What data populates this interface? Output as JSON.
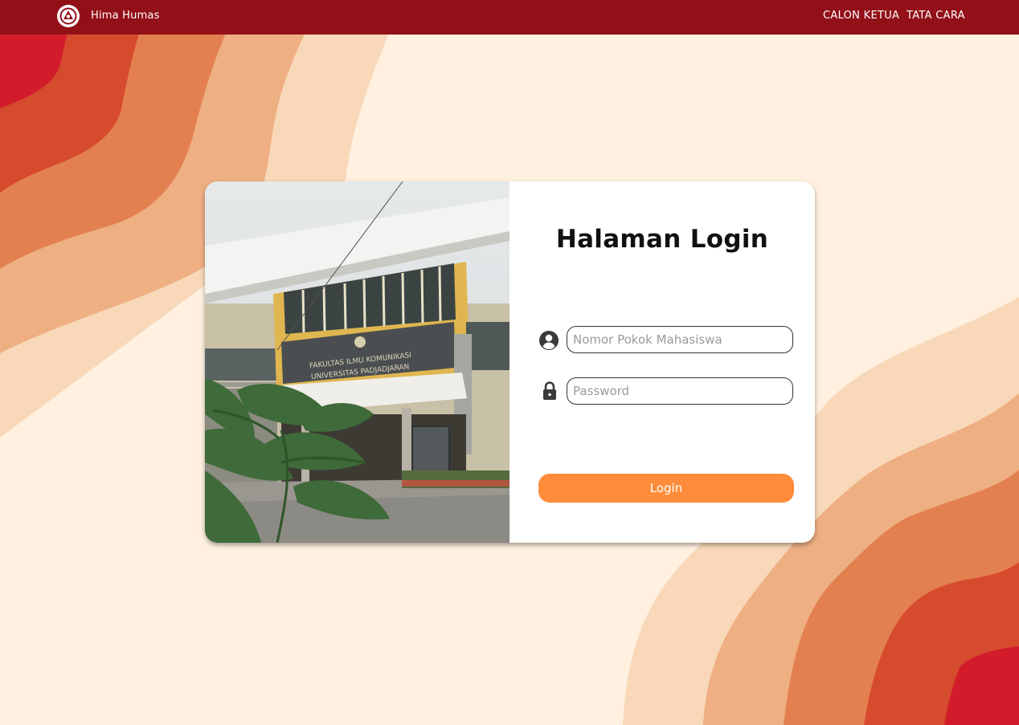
{
  "navbar": {
    "brand_name": "Hima Humas",
    "links": [
      "CALON KETUA",
      "TATA CARA"
    ],
    "background_color": "#921018"
  },
  "login": {
    "title": "Halaman Login",
    "npm_placeholder": "Nomor Pokok Mahasiswa",
    "password_placeholder": "Password",
    "button_label": "Login",
    "button_color": "#ff8c3a"
  },
  "photo": {
    "sign_text_line1": "FAKULTAS ILMU KOMUNIKASI",
    "sign_text_line2": "UNIVERSITAS PADJADJARAN"
  },
  "icons": {
    "brand": "emblem-logo-icon",
    "user": "user-circle-icon",
    "lock": "lock-icon"
  },
  "colors": {
    "background": "#fff0e0",
    "wave_light": "#f8d8b8",
    "wave_peach": "#eeaf83",
    "wave_orange": "#e3804f",
    "wave_red_orange": "#d64a2e",
    "wave_red": "#d21c2b"
  }
}
